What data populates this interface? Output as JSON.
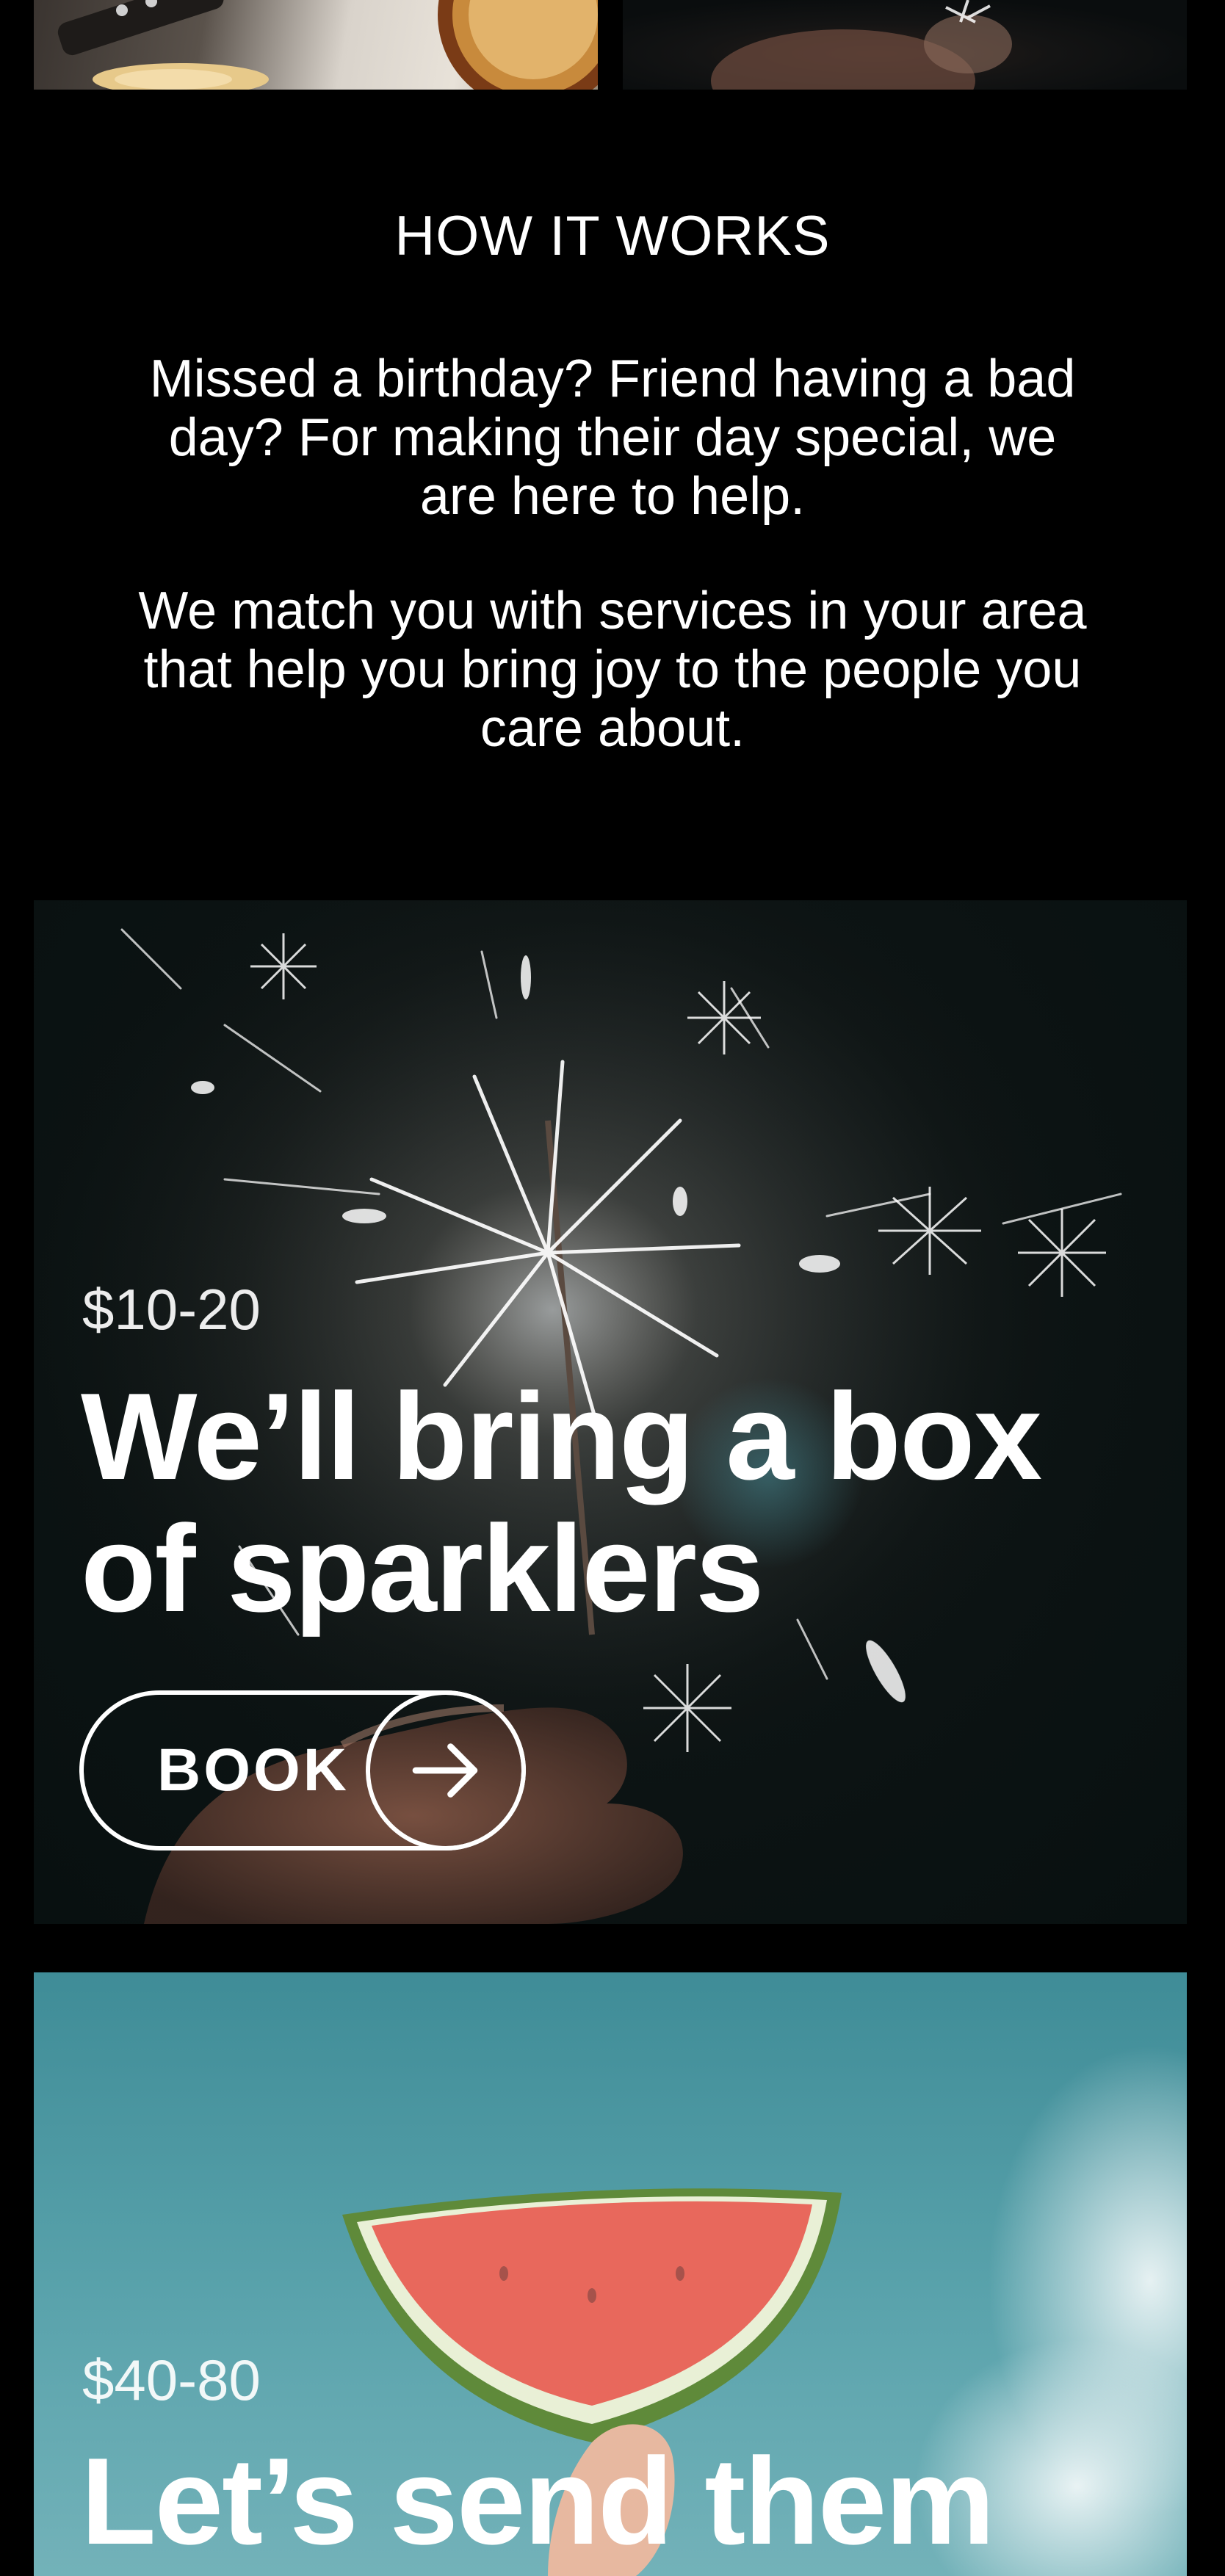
{
  "how_it_works": {
    "title": "HOW IT WORKS",
    "paragraph_1": "Missed a birthday? Friend having a bad day? For making their day special, we are here to help.",
    "paragraph_2": "We match you with services in your area that help you bring joy to the people you care about."
  },
  "cards": [
    {
      "price": "$10-20",
      "headline": "We’ll bring a box of sparklers",
      "button_label": "BOOK",
      "button_icon": "arrow-right-icon",
      "image": "sparklers-image"
    },
    {
      "price": "$40-80",
      "headline": "Let’s send them",
      "image": "watermelon-image"
    }
  ],
  "colors": {
    "background": "#000000",
    "text": "#ffffff",
    "sky": "#5aa3ac"
  }
}
